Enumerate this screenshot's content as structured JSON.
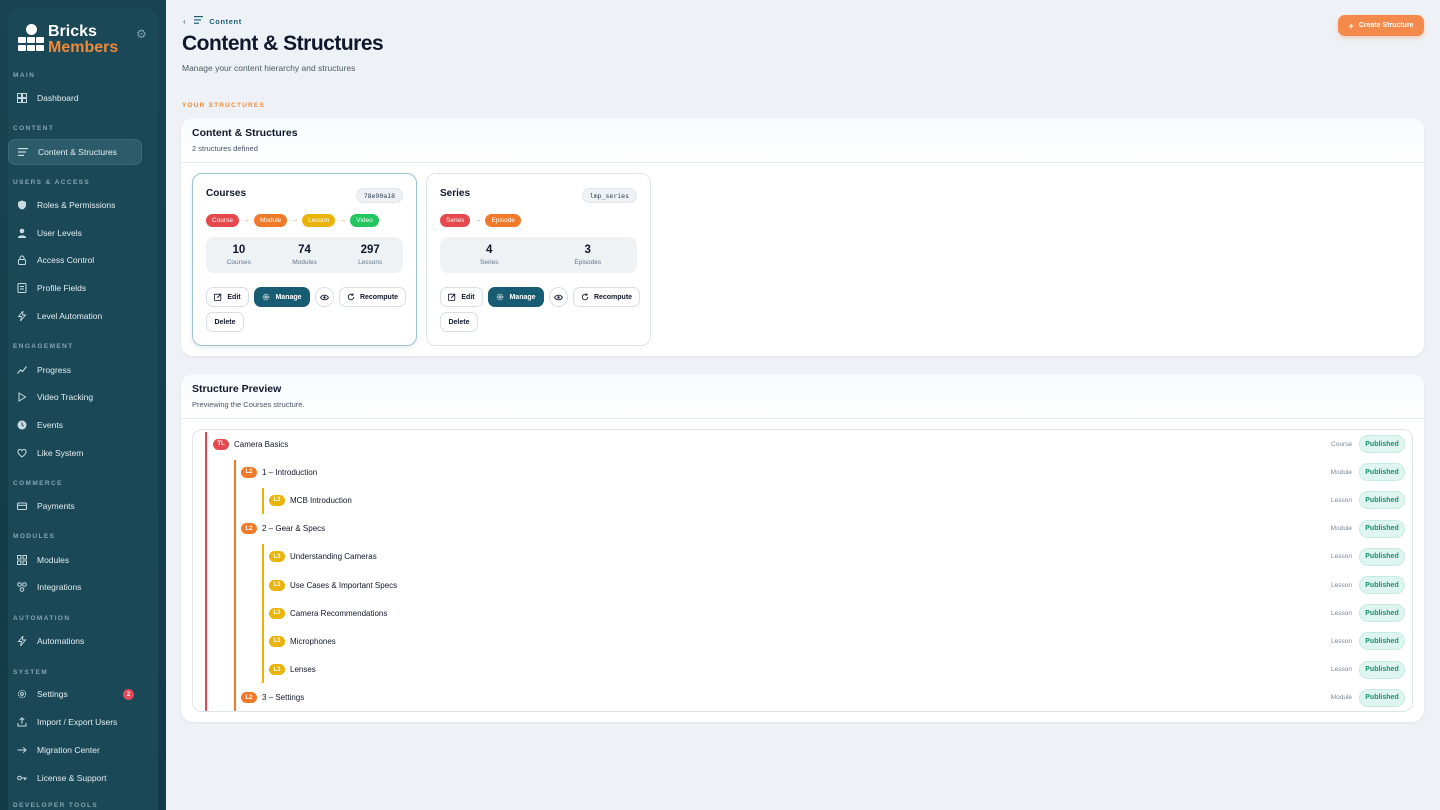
{
  "brand": {
    "line1": "Bricks",
    "line2": "Members"
  },
  "sidebar": {
    "sections": [
      {
        "label": "MAIN",
        "items": [
          {
            "label": "Dashboard",
            "icon": "dashboard-icon"
          }
        ]
      },
      {
        "label": "CONTENT",
        "items": [
          {
            "label": "Content & Structures",
            "icon": "list-icon",
            "active": true
          }
        ]
      },
      {
        "label": "USERS & ACCESS",
        "items": [
          {
            "label": "Roles & Permissions",
            "icon": "shield-icon"
          },
          {
            "label": "User Levels",
            "icon": "user-icon"
          },
          {
            "label": "Access Control",
            "icon": "lock-icon"
          },
          {
            "label": "Profile Fields",
            "icon": "form-icon"
          },
          {
            "label": "Level Automation",
            "icon": "bolt-icon"
          }
        ]
      },
      {
        "label": "ENGAGEMENT",
        "items": [
          {
            "label": "Progress",
            "icon": "trend-icon"
          },
          {
            "label": "Video Tracking",
            "icon": "play-icon"
          },
          {
            "label": "Events",
            "icon": "clock-icon"
          },
          {
            "label": "Like System",
            "icon": "heart-icon"
          }
        ]
      },
      {
        "label": "COMMERCE",
        "items": [
          {
            "label": "Payments",
            "icon": "card-icon"
          }
        ]
      },
      {
        "label": "MODULES",
        "items": [
          {
            "label": "Modules",
            "icon": "grid-icon"
          },
          {
            "label": "Integrations",
            "icon": "integrations-icon"
          }
        ]
      },
      {
        "label": "AUTOMATION",
        "items": [
          {
            "label": "Automations",
            "icon": "bolt-icon"
          }
        ]
      },
      {
        "label": "SYSTEM",
        "items": [
          {
            "label": "Settings",
            "icon": "gear-icon",
            "badge": "2"
          },
          {
            "label": "Import / Export Users",
            "icon": "upload-icon"
          },
          {
            "label": "Migration Center",
            "icon": "arrow-right-icon"
          },
          {
            "label": "License & Support",
            "icon": "key-icon"
          }
        ]
      },
      {
        "label": "DEVELOPER TOOLS",
        "items": []
      }
    ]
  },
  "header": {
    "breadcrumb": "Content",
    "title": "Content & Structures",
    "subtitle": "Manage your content hierarchy and structures",
    "create_label": "Create Structure",
    "section_label": "YOUR STRUCTURES"
  },
  "structures_panel": {
    "title": "Content & Structures",
    "subtitle": "2 structures defined",
    "cards": [
      {
        "title": "Courses",
        "code": "78e90a18",
        "chips": [
          {
            "label": "Course",
            "color": "#e5484d"
          },
          {
            "label": "Module",
            "color": "#f07a2a"
          },
          {
            "label": "Lesson",
            "color": "#eab308"
          },
          {
            "label": "Video",
            "color": "#22c55e"
          }
        ],
        "stats": [
          {
            "n": "10",
            "l": "Courses"
          },
          {
            "n": "74",
            "l": "Modules"
          },
          {
            "n": "297",
            "l": "Lessons"
          }
        ]
      },
      {
        "title": "Series",
        "code": "lmp_series",
        "chips": [
          {
            "label": "Series",
            "color": "#e5484d"
          },
          {
            "label": "Episode",
            "color": "#f07a2a"
          }
        ],
        "stats": [
          {
            "n": "4",
            "l": "Series"
          },
          {
            "n": "3",
            "l": "Episodes"
          }
        ]
      }
    ],
    "buttons": {
      "edit": "Edit",
      "manage": "Manage",
      "recompute": "Recompute",
      "delete": "Delete"
    }
  },
  "preview_panel": {
    "title": "Structure Preview",
    "subtitle": "Previewing the Courses structure.",
    "rows": [
      {
        "level": "TL",
        "depth": 0,
        "name": "Camera Basics",
        "type": "Course",
        "status": "Published"
      },
      {
        "level": "L2",
        "depth": 1,
        "name": "1 – Introduction",
        "type": "Module",
        "status": "Published"
      },
      {
        "level": "L3",
        "depth": 2,
        "name": "MCB Introduction",
        "type": "Lesson",
        "status": "Published"
      },
      {
        "level": "L2",
        "depth": 1,
        "name": "2 – Gear & Specs",
        "type": "Module",
        "status": "Published"
      },
      {
        "level": "L3",
        "depth": 2,
        "name": "Understanding Cameras",
        "type": "Lesson",
        "status": "Published"
      },
      {
        "level": "L3",
        "depth": 2,
        "name": "Use Cases & Important Specs",
        "type": "Lesson",
        "status": "Published"
      },
      {
        "level": "L3",
        "depth": 2,
        "name": "Camera Recommendations",
        "type": "Lesson",
        "status": "Published"
      },
      {
        "level": "L3",
        "depth": 2,
        "name": "Microphones",
        "type": "Lesson",
        "status": "Published"
      },
      {
        "level": "L3",
        "depth": 2,
        "name": "Lenses",
        "type": "Lesson",
        "status": "Published"
      },
      {
        "level": "L2",
        "depth": 1,
        "name": "3 – Settings",
        "type": "Module",
        "status": "Published"
      }
    ]
  },
  "colors": {
    "tl": "#e5484d",
    "l2": "#f07a2a",
    "l3": "#eab308",
    "accent": "#f3894a",
    "primary": "#175c72"
  }
}
